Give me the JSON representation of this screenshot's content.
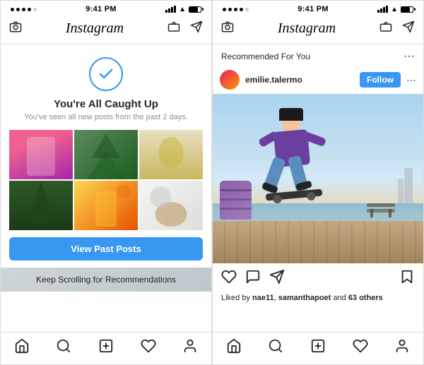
{
  "left_phone": {
    "status": {
      "time": "9:41 PM"
    },
    "nav": {
      "title": "Instagram"
    },
    "caught_up": {
      "title": "You're All Caught Up",
      "subtitle": "You've seen all new posts from the past 2 days."
    },
    "view_past_btn": "View Past Posts",
    "keep_scrolling": "Keep Scrolling for Recommendations"
  },
  "right_phone": {
    "status": {
      "time": "9:41 PM"
    },
    "nav": {
      "title": "Instagram"
    },
    "recommended_label": "Recommended For You",
    "post": {
      "username": "emilie.talermo",
      "follow_label": "Follow",
      "liked_by": "Liked by nae11, samanthapoet and 63 others"
    }
  },
  "icons": {
    "camera": "📷",
    "home": "⌂",
    "search": "🔍",
    "add": "⊕",
    "heart": "♡",
    "profile": "👤",
    "bookmark": "🔖",
    "comment": "💬",
    "share": "✈",
    "three_dots": "···",
    "check": "✓"
  }
}
